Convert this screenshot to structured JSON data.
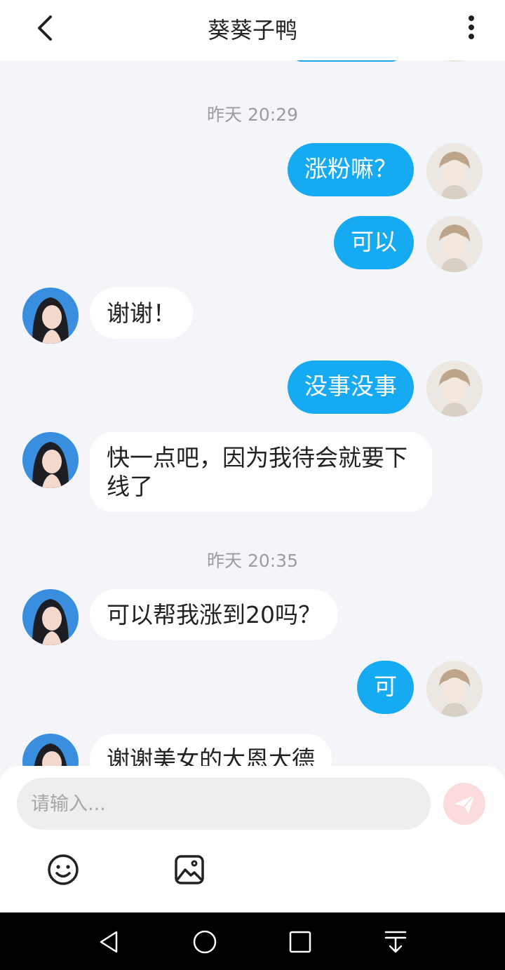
{
  "header": {
    "title": "葵葵子鸭"
  },
  "messages_timestamps": [
    "昨天 20:29",
    "昨天 20:35"
  ],
  "messages": [
    {
      "text": "涨粉嘛？"
    },
    {
      "text": "可以"
    },
    {
      "text": "谢谢！"
    },
    {
      "text": "没事没事"
    },
    {
      "text": "快一点吧，因为我待会就要下线了"
    },
    {
      "text": "可以帮我涨到20吗？"
    },
    {
      "text": "可"
    },
    {
      "text": "谢谢美女的大恩大德"
    }
  ],
  "composer": {
    "placeholder": "请输入..."
  },
  "colors": {
    "accent": "#16aaf2",
    "background": "#f3f5f8",
    "send_bg": "#fbdcdc"
  },
  "icons": [
    "back-icon",
    "more-vertical-icon",
    "send-icon",
    "emoji-icon",
    "image-icon",
    "nav-back-icon",
    "nav-home-icon",
    "nav-recents-icon",
    "nav-download-icon"
  ]
}
